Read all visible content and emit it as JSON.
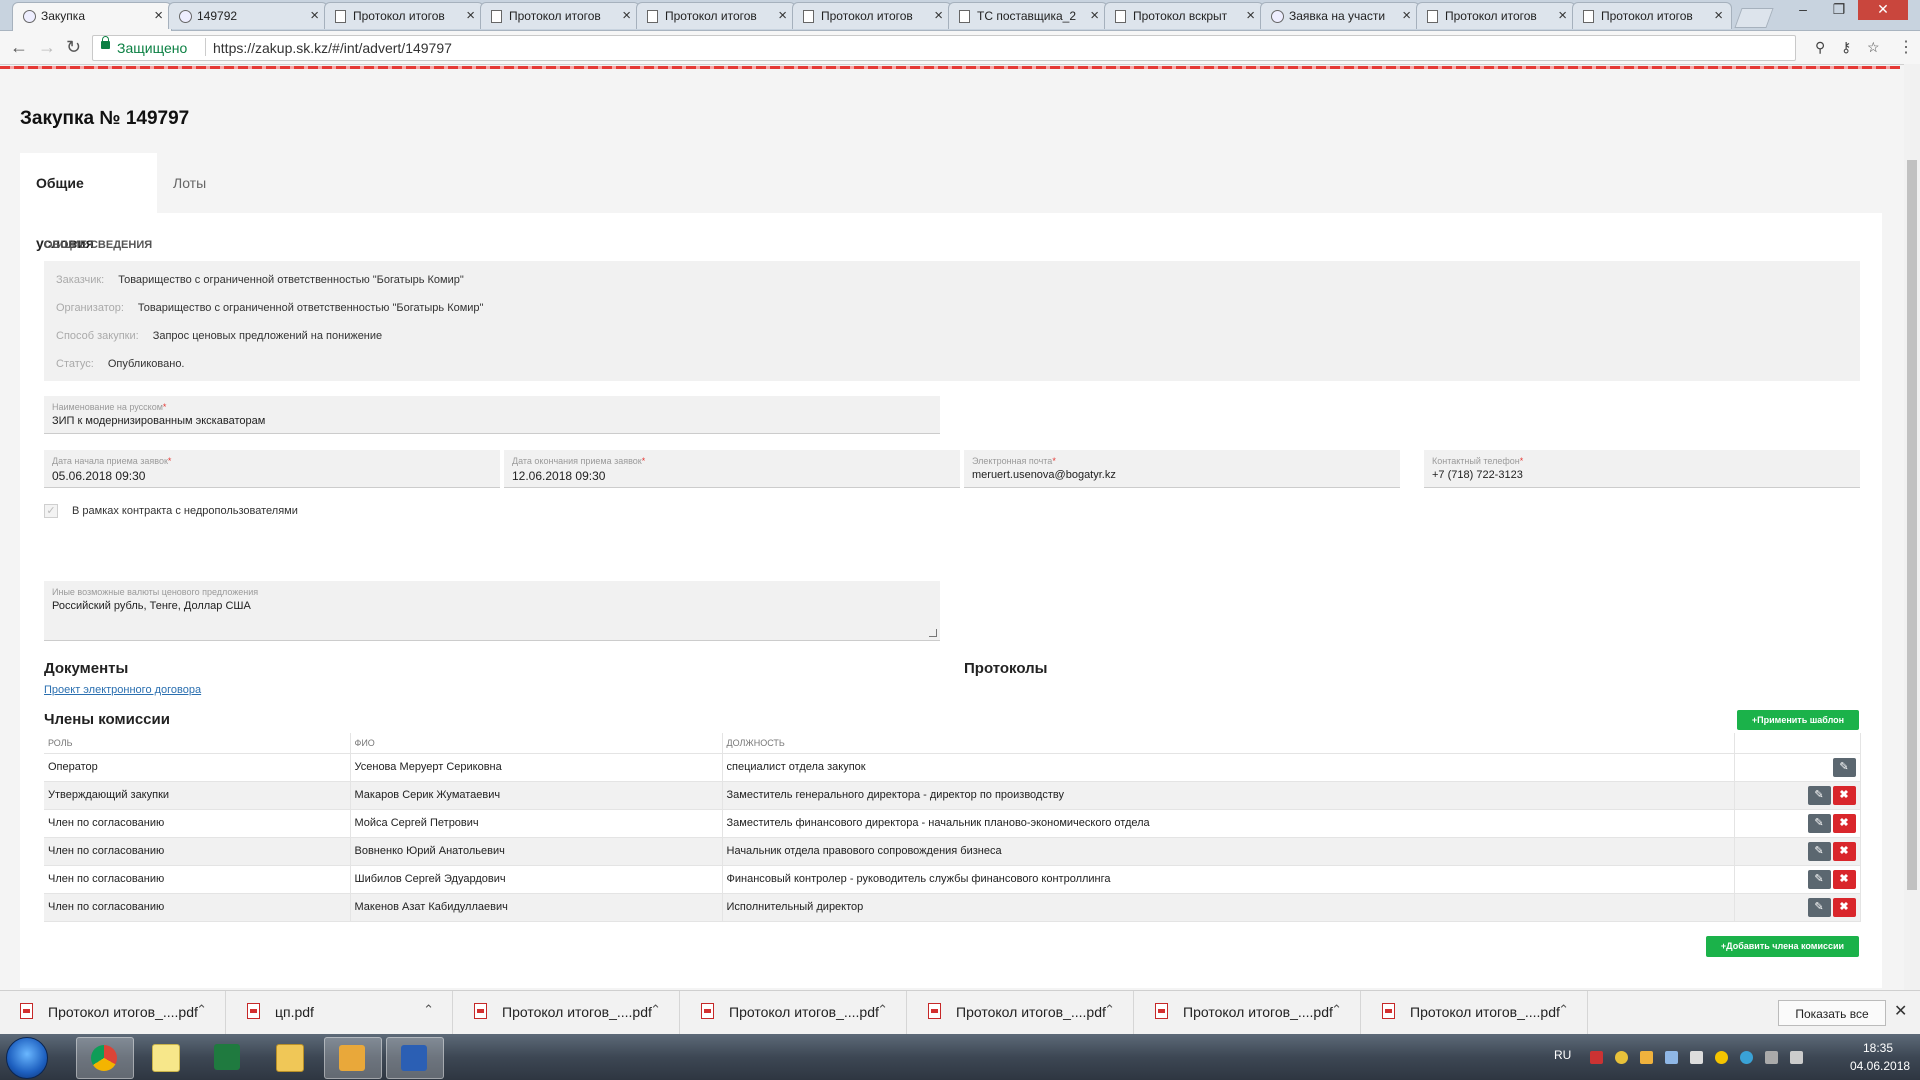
{
  "browser": {
    "tabs": [
      {
        "label": "Закупка",
        "icon": "globe"
      },
      {
        "label": "149792",
        "icon": "globe"
      },
      {
        "label": "Протокол итогов",
        "icon": "document"
      },
      {
        "label": "Протокол итогов",
        "icon": "document"
      },
      {
        "label": "Протокол итогов",
        "icon": "document"
      },
      {
        "label": "Протокол итогов",
        "icon": "document"
      },
      {
        "label": "ТС поставщика_2",
        "icon": "document"
      },
      {
        "label": "Протокол вскрыт",
        "icon": "document"
      },
      {
        "label": "Заявка на участи",
        "icon": "gear"
      },
      {
        "label": "Протокол итогов",
        "icon": "document"
      },
      {
        "label": "Протокол итогов",
        "icon": "document"
      }
    ],
    "secure_label": "Защищено",
    "url": "https://zakup.sk.kz/#/int/advert/149797"
  },
  "page": {
    "title": "Закупка № 149797",
    "tabs": [
      "Общие условия",
      "Лоты"
    ],
    "general_title": "ОБЩИЕ СВЕДЕНИЯ",
    "general": [
      {
        "label": "Заказчик:",
        "value": "Товарищество с ограниченной ответственностью \"Богатырь Комир\""
      },
      {
        "label": "Организатор:",
        "value": "Товарищество с ограниченной ответственностью \"Богатырь Комир\""
      },
      {
        "label": "Способ закупки:",
        "value": "Запрос ценовых предложений на понижение"
      },
      {
        "label": "Статус:",
        "value": "Опубликовано."
      }
    ],
    "fields": {
      "name_ru": {
        "label": "Наименование на русском",
        "value": "ЗИП к модернизированным экскаваторам"
      },
      "start_date": {
        "label": "Дата начала приема заявок",
        "value": "05.06.2018 09:30"
      },
      "end_date": {
        "label": "Дата окончания приема заявок",
        "value": "12.06.2018 09:30"
      },
      "email": {
        "label": "Электронная почта",
        "value": "meruert.usenova@bogatyr.kz"
      },
      "phone": {
        "label": "Контактный телефон",
        "value": "+7 (718) 722-3123"
      },
      "currencies": {
        "label": "Иные возможные валюты ценового предложения",
        "value": "Российский  рубль, Тенге, Доллар США"
      }
    },
    "required_mark": "*",
    "checkbox_label": "В рамках контракта с недропользователями",
    "documents_title": "Документы",
    "documents_link": "Проект электронного договора",
    "protocols_title": "Протоколы",
    "members_title": "Члены комиссии",
    "apply_template_label": "Применить шаблон",
    "add_member_label": "Добавить члена комиссии",
    "table_headers": [
      "РОЛЬ",
      "ФИО",
      "ДОЛЖНОСТЬ"
    ],
    "members": [
      {
        "role": "Оператор",
        "name": "Усенова Меруерт Сериковна",
        "position": "специалист отдела закупок",
        "deletable": false
      },
      {
        "role": "Утверждающий закупки",
        "name": "Макаров Серик Жуматаевич",
        "position": "Заместитель генерального директора - директор по производству",
        "deletable": true
      },
      {
        "role": "Член по согласованию",
        "name": "Мойса Сергей Петрович",
        "position": "Заместитель финансового директора - начальник планово-экономического отдела",
        "deletable": true
      },
      {
        "role": "Член по согласованию",
        "name": "Вовненко Юрий Анатольевич",
        "position": "Начальник отдела правового сопровождения бизнеса",
        "deletable": true
      },
      {
        "role": "Член по согласованию",
        "name": "Шибилов Сергей Эдуардович",
        "position": "Финансовый контролер - руководитель службы финансового контроллинга",
        "deletable": true
      },
      {
        "role": "Член по согласованию",
        "name": "Макенов Азат Кабидуллаевич",
        "position": "Исполнительный директор",
        "deletable": true
      }
    ]
  },
  "downloads": {
    "items": [
      "Протокол итогов_....pdf",
      "цп.pdf",
      "Протокол итогов_....pdf",
      "Протокол итогов_....pdf",
      "Протокол итогов_....pdf",
      "Протокол итогов_....pdf",
      "Протокол итогов_....pdf"
    ],
    "show_all": "Показать все"
  },
  "taskbar": {
    "lang": "RU",
    "time": "18:35",
    "date": "04.06.2018",
    "apps": [
      "chrome",
      "notes",
      "excel",
      "explorer",
      "outlook",
      "word"
    ]
  },
  "colors": {
    "accent_green": "#1bb24a",
    "danger_red": "#d9262b",
    "link_blue": "#2a6fb0",
    "secure_green": "#0b8043"
  }
}
